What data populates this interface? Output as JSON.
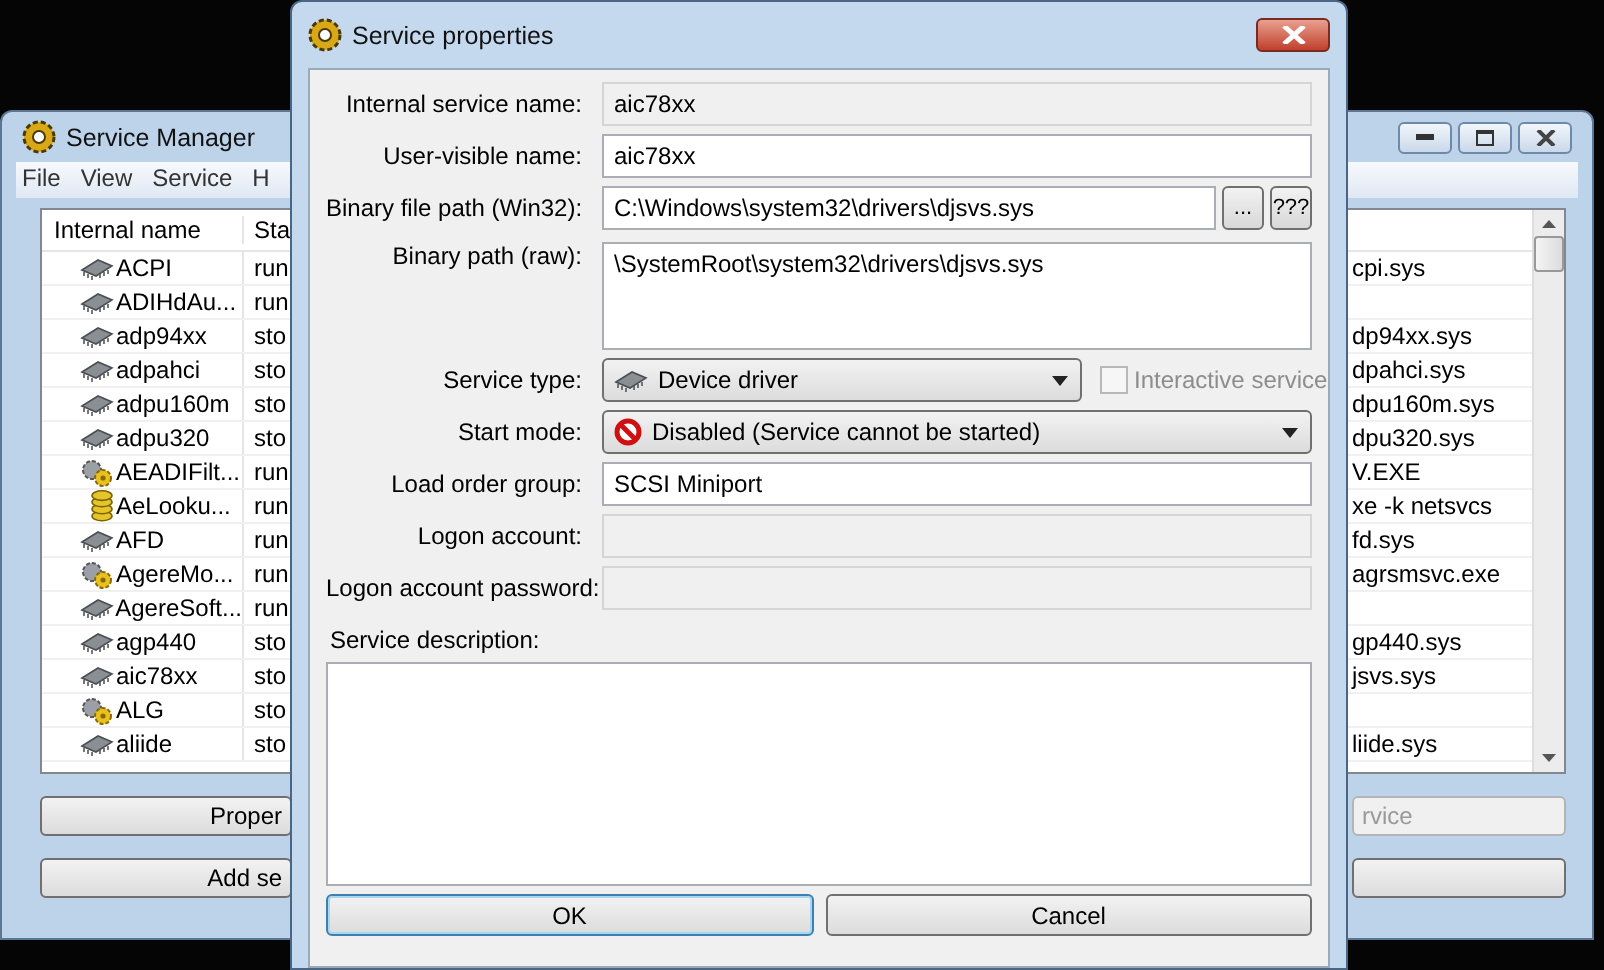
{
  "main_window": {
    "title": "Service Manager",
    "menu": [
      "File",
      "View",
      "Service",
      "H"
    ],
    "columns": [
      "Internal name",
      "Sta"
    ],
    "rows": [
      {
        "name": "ACPI",
        "status": "run",
        "path": "cpi.sys",
        "kind": "driver"
      },
      {
        "name": "ADIHdAu...",
        "status": "run",
        "kind": "driver"
      },
      {
        "name": "adp94xx",
        "status": "sto",
        "path": "dp94xx.sys",
        "kind": "driver"
      },
      {
        "name": "adpahci",
        "status": "sto",
        "path": "dpahci.sys",
        "kind": "driver"
      },
      {
        "name": "adpu160m",
        "status": "sto",
        "path": "dpu160m.sys",
        "kind": "driver"
      },
      {
        "name": "adpu320",
        "status": "sto",
        "path": "dpu320.sys",
        "kind": "driver"
      },
      {
        "name": "AEADIFilt...",
        "status": "run",
        "path": "V.EXE",
        "kind": "service"
      },
      {
        "name": "AeLooku...",
        "status": "run",
        "path": "xe -k netsvcs",
        "kind": "shared"
      },
      {
        "name": "AFD",
        "status": "run",
        "path": "fd.sys",
        "kind": "driver"
      },
      {
        "name": "AgereMo...",
        "status": "run",
        "path": "agrsmsvc.exe",
        "kind": "service"
      },
      {
        "name": "AgereSoft...",
        "status": "run",
        "kind": "driver"
      },
      {
        "name": "agp440",
        "status": "sto",
        "path": "gp440.sys",
        "kind": "driver"
      },
      {
        "name": "aic78xx",
        "status": "sto",
        "path": "jsvs.sys",
        "kind": "driver"
      },
      {
        "name": "ALG",
        "status": "sto",
        "kind": "service"
      },
      {
        "name": "aliide",
        "status": "sto",
        "path": "liide.sys",
        "kind": "driver"
      }
    ],
    "buttons": [
      {
        "left": "Proper",
        "right": "rvice",
        "disabled": true
      },
      {
        "left": "Add se",
        "disabled": false
      }
    ]
  },
  "dialog": {
    "title": "Service properties",
    "fields": [
      {
        "label": "Internal service name:",
        "value": "aic78xx",
        "kind": "readonly"
      },
      {
        "label": "User-visible name:",
        "value": "aic78xx",
        "kind": "text"
      },
      {
        "label": "Binary file path (Win32):",
        "value": "C:\\Windows\\system32\\drivers\\djsvs.sys",
        "kind": "path",
        "buttons": [
          "...",
          "???"
        ]
      },
      {
        "label": "Binary path (raw):",
        "value": "\\SystemRoot\\system32\\drivers\\djsvs.sys",
        "kind": "multiline"
      },
      {
        "label": "Service type:",
        "value": "Device driver",
        "kind": "type-select",
        "checkbox": {
          "label": "Interactive service",
          "checked": false,
          "disabled": true
        }
      },
      {
        "label": "Start mode:",
        "value": "Disabled (Service cannot be started)",
        "kind": "mode-select"
      },
      {
        "label": "Load order group:",
        "value": "SCSI Miniport",
        "kind": "text"
      },
      {
        "label": "Logon account:",
        "kind": "disabled"
      },
      {
        "label": "Logon account password:",
        "kind": "disabled"
      }
    ],
    "description_label": "Service description:",
    "buttons": [
      "OK",
      "Cancel"
    ]
  }
}
